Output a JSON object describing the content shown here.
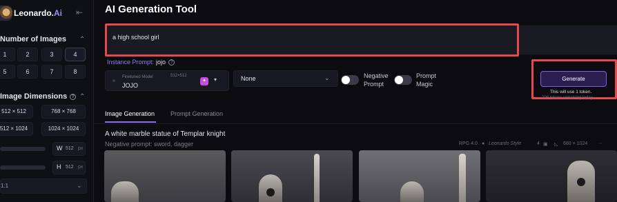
{
  "app": {
    "logo_text": "Leonardo.",
    "logo_ai": "Ai",
    "collapse_icon": "collapse-arrow-icon"
  },
  "sidebar": {
    "num_images_title": "Number of Images",
    "num_images_options": [
      "1",
      "2",
      "3",
      "4",
      "5",
      "6",
      "7",
      "8"
    ],
    "num_images_selected": "4",
    "dimensions_title": "Image Dimensions",
    "dimension_options": [
      "512 × 512",
      "768 × 768",
      "512 × 1024",
      "1024 × 1024"
    ],
    "width_label": "W",
    "width_value": "512",
    "height_label": "H",
    "height_value": "512",
    "px_unit": "px",
    "aspect_ratio": "1:1"
  },
  "main": {
    "title": "AI Generation Tool",
    "prompt_value": "a high school girl",
    "instance_prompt_label": "Instance Prompt:",
    "instance_prompt_value": "jojo",
    "model": {
      "kind": "Finetuned Model",
      "name": "JOJO",
      "size": "512×512"
    },
    "style_value": "None",
    "negative_prompt_label_1": "Negative",
    "negative_prompt_label_2": "Prompt",
    "prompt_magic_label_1": "Prompt",
    "prompt_magic_label_2": "Magic",
    "generate_label": "Generate",
    "token_note": "This will use 1 token.",
    "tokens_remaining": "206 tokens remaining today."
  },
  "tabs": [
    {
      "label": "Image Generation",
      "active": true
    },
    {
      "label": "Prompt Generation",
      "active": false
    }
  ],
  "generation": {
    "title": "A white marble statue of Templar knight",
    "negative_prompt": "Negative prompt: sword, dagger",
    "model": "RPG 4.0",
    "style": "Leonardo Style",
    "count": "4",
    "dimensions": "680 × 1024",
    "more": "···"
  },
  "colors": {
    "accent": "#8c6cf2",
    "highlight": "#e5484d",
    "background": "#0b0b10"
  }
}
